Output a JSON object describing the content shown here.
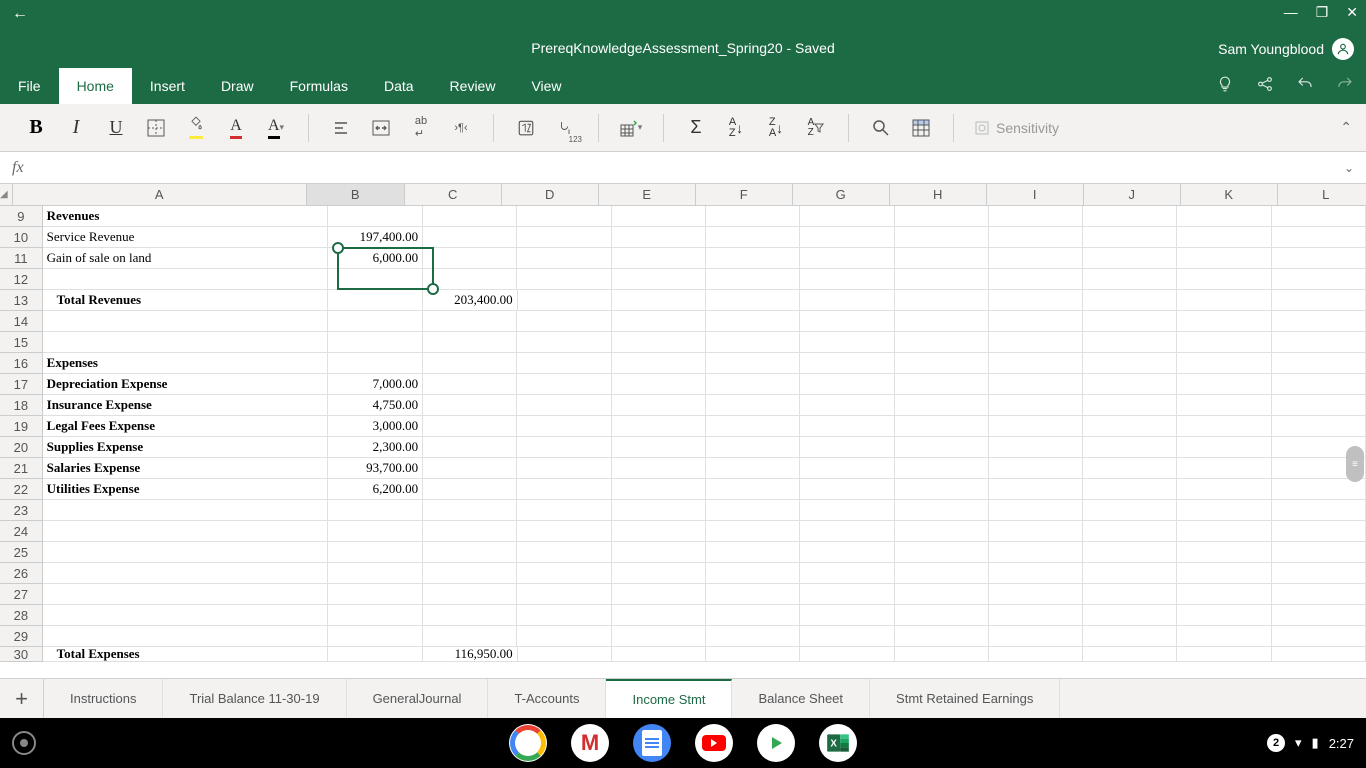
{
  "titlebar": {
    "document_title": "PrereqKnowledgeAssessment_Spring20 - Saved",
    "user_name": "Sam Youngblood"
  },
  "tabs": {
    "items": [
      "File",
      "Home",
      "Insert",
      "Draw",
      "Formulas",
      "Data",
      "Review",
      "View"
    ],
    "active_index": 1
  },
  "ribbon": {
    "sensitivity_label": "Sensitivity"
  },
  "columns": [
    "A",
    "B",
    "C",
    "D",
    "E",
    "F",
    "G",
    "H",
    "I",
    "J",
    "K",
    "L"
  ],
  "selected_column_index": 1,
  "rows": [
    {
      "n": 9,
      "A": "Revenues",
      "A_bold": true
    },
    {
      "n": 10,
      "A": "Service Revenue",
      "B": "197,400.00"
    },
    {
      "n": 11,
      "A": "Gain of sale on land",
      "B": "6,000.00"
    },
    {
      "n": 12
    },
    {
      "n": 13,
      "A": "Total Revenues",
      "A_bold": true,
      "A_indent": true,
      "C": "203,400.00"
    },
    {
      "n": 14
    },
    {
      "n": 15
    },
    {
      "n": 16,
      "A": "Expenses",
      "A_bold": true
    },
    {
      "n": 17,
      "A": "Depreciation Expense",
      "A_bold": true,
      "B": "7,000.00"
    },
    {
      "n": 18,
      "A": "Insurance Expense",
      "A_bold": true,
      "B": "4,750.00"
    },
    {
      "n": 19,
      "A": "Legal Fees Expense",
      "A_bold": true,
      "B": "3,000.00"
    },
    {
      "n": 20,
      "A": "Supplies Expense",
      "A_bold": true,
      "B": "2,300.00"
    },
    {
      "n": 21,
      "A": "Salaries Expense",
      "A_bold": true,
      "B": "93,700.00"
    },
    {
      "n": 22,
      "A": "Utilities Expense",
      "A_bold": true,
      "B": "6,200.00"
    },
    {
      "n": 23
    },
    {
      "n": 24
    },
    {
      "n": 25
    },
    {
      "n": 26
    },
    {
      "n": 27
    },
    {
      "n": 28
    },
    {
      "n": 29
    },
    {
      "n": 30,
      "A": "Total Expenses",
      "A_bold": true,
      "A_indent": true,
      "C": "116,950.00",
      "partial": true
    }
  ],
  "selection": {
    "range": "B11:B12"
  },
  "sheet_tabs": {
    "items": [
      "Instructions",
      "Trial Balance 11-30-19",
      "GeneralJournal",
      "T-Accounts",
      "Income Stmt",
      "Balance Sheet",
      "Stmt Retained Earnings"
    ],
    "active_index": 4
  },
  "taskbar": {
    "notification_count": "2",
    "time": "2:27"
  }
}
